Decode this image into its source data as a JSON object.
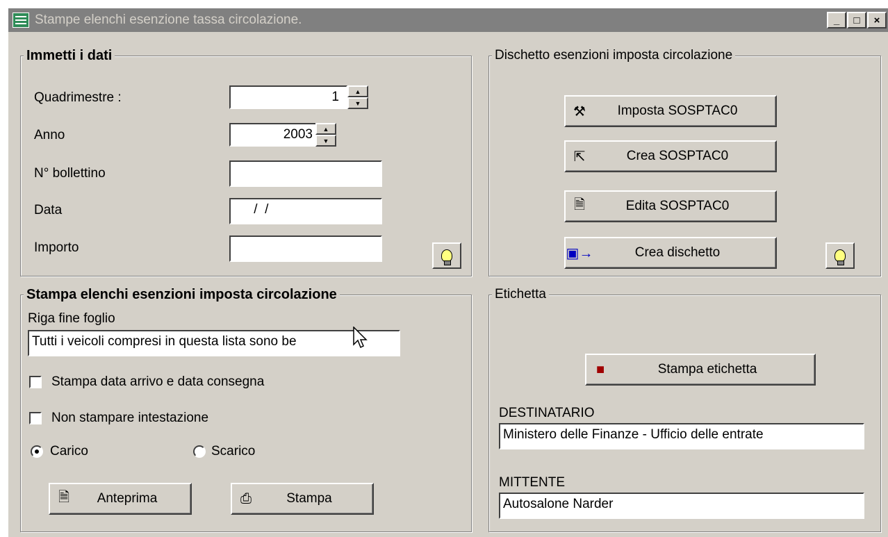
{
  "window": {
    "title": "Stampe elenchi esenzione tassa circolazione.",
    "controls": [
      "_",
      "□",
      "×"
    ]
  },
  "immetti": {
    "legend": "Immetti i dati",
    "quadrimestre_label": "Quadrimestre :",
    "quadrimestre_value": "1",
    "anno_label": "Anno",
    "anno_value": "2003",
    "bollettino_label": "N° bollettino",
    "bollettino_value": "",
    "data_label": "Data",
    "data_value": " /  /",
    "importo_label": "Importo",
    "importo_value": ""
  },
  "dischetto": {
    "legend": "Dischetto esenzioni imposta circolazione",
    "imposta_label": "Imposta SOSPTAC0",
    "crea_label": "Crea SOSPTAC0",
    "edita_label": "Edita SOSPTAC0",
    "dischetto_label": "Crea dischetto"
  },
  "stampa": {
    "legend": "Stampa elenchi esenzioni imposta circolazione",
    "riga_label": "Riga fine foglio",
    "riga_value": "Tutti i veicoli compresi in questa lista sono be",
    "data_arrivo_label": "Stampa data arrivo e data consegna",
    "data_arrivo_checked": false,
    "intestazione_label": "Non stampare intestazione",
    "intestazione_checked": false,
    "carico_label": "Carico",
    "scarico_label": "Scarico",
    "selected": "Carico",
    "anteprima_label": "Anteprima",
    "stampa_label": "Stampa"
  },
  "etichetta": {
    "legend": "Etichetta",
    "stampa_etichetta_label": "Stampa etichetta",
    "destinatario_label": "DESTINATARIO",
    "destinatario_value": "Ministero delle Finanze - Ufficio delle entrate",
    "mittente_label": "MITTENTE",
    "mittente_value": "Autosalone Narder"
  },
  "colors": {
    "face": "#d4d0c8",
    "titlebar_inactive": "#808080",
    "field_bg": "#ffffff"
  }
}
